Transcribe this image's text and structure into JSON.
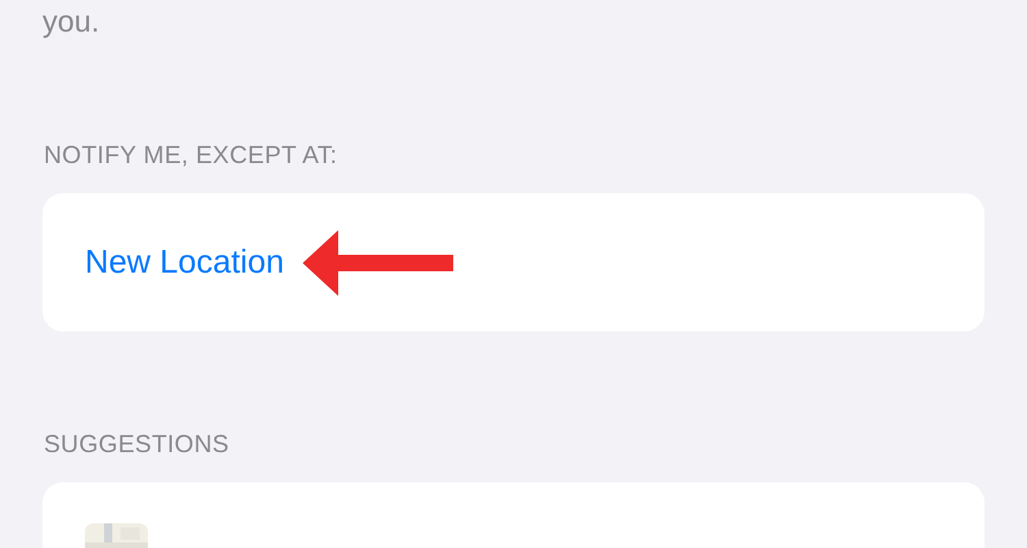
{
  "intro_text": "you.",
  "except_section": {
    "header": "NOTIFY ME, EXCEPT AT:",
    "items": [
      {
        "label": "New Location",
        "annotated": true
      }
    ]
  },
  "suggestions_section": {
    "header": "SUGGESTIONS"
  }
}
